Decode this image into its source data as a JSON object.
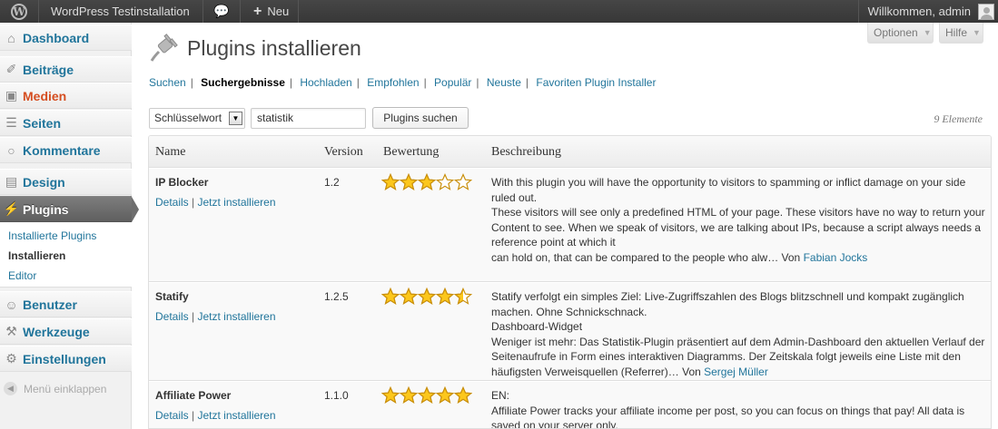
{
  "adminbar": {
    "site_name": "WordPress Testinstallation",
    "new_label": "Neu",
    "welcome": "Willkommen, admin"
  },
  "sidebar": {
    "items": [
      {
        "label": "Dashboard",
        "icon": "dashboard-icon"
      },
      {
        "label": "Beiträge",
        "icon": "pin-icon"
      },
      {
        "label": "Medien",
        "icon": "media-icon"
      },
      {
        "label": "Seiten",
        "icon": "pages-icon"
      },
      {
        "label": "Kommentare",
        "icon": "comment-icon"
      },
      {
        "label": "Design",
        "icon": "design-icon"
      },
      {
        "label": "Plugins",
        "icon": "plugin-icon"
      },
      {
        "label": "Benutzer",
        "icon": "users-icon"
      },
      {
        "label": "Werkzeuge",
        "icon": "tools-icon"
      },
      {
        "label": "Einstellungen",
        "icon": "settings-icon"
      }
    ],
    "submenu": [
      "Installierte Plugins",
      "Installieren",
      "Editor"
    ],
    "collapse_label": "Menü einklappen"
  },
  "screen_meta": {
    "options_label": "Optionen",
    "help_label": "Hilfe"
  },
  "page": {
    "title": "Plugins installieren"
  },
  "tabs": [
    "Suchen",
    "Suchergebnisse",
    "Hochladen",
    "Empfohlen",
    "Populär",
    "Neuste",
    "Favoriten Plugin Installer"
  ],
  "search": {
    "type_value": "Schlüsselwort",
    "term_value": "statistik",
    "button_label": "Plugins suchen",
    "count": "9 Elemente"
  },
  "table": {
    "headers": [
      "Name",
      "Version",
      "Bewertung",
      "Beschreibung"
    ],
    "rows": [
      {
        "name": "IP Blocker",
        "details": "Details",
        "install": "Jetzt installieren",
        "version": "1.2",
        "rating": 3,
        "desc_lines": [
          "With this plugin you will have the opportunity to visitors to spamming or inflict damage on your side ruled out.",
          "These visitors will see only a predefined HTML of your page. These visitors have no way to return your",
          "Content to see. When we speak of visitors, we are talking about IPs, because a script always needs a reference point at which it",
          "can hold on, that can be compared to the people who alw… Von "
        ],
        "author": "Fabian Jocks"
      },
      {
        "name": "Statify",
        "details": "Details",
        "install": "Jetzt installieren",
        "version": "1.2.5",
        "rating": 4.5,
        "desc_lines": [
          "Statify verfolgt ein simples Ziel: Live-Zugriffszahlen des Blogs blitzschnell und kompakt zugänglich machen. Ohne Schnickschnack.",
          "Dashboard-Widget",
          "Weniger ist mehr: Das Statistik-Plugin präsentiert auf dem Admin-Dashboard den aktuellen Verlauf der Seitenaufrufe in Form eines interaktiven Diagramms. Der Zeitskala folgt jeweils eine Liste mit den häufigsten Verweisquellen (Referrer)… Von "
        ],
        "author": "Sergej Müller"
      },
      {
        "name": "Affiliate Power",
        "details": "Details",
        "install": "Jetzt installieren",
        "version": "1.1.0",
        "rating": 5,
        "desc_lines": [
          "EN:",
          "Affiliate Power tracks your affiliate income per post, so you can focus on things that pay! All data is saved on your server only."
        ],
        "author": ""
      }
    ]
  },
  "colors": {
    "link": "#21759b",
    "medien": "#d54e21",
    "star_fill": "#fcc71c",
    "star_stroke": "#c98f0b"
  }
}
